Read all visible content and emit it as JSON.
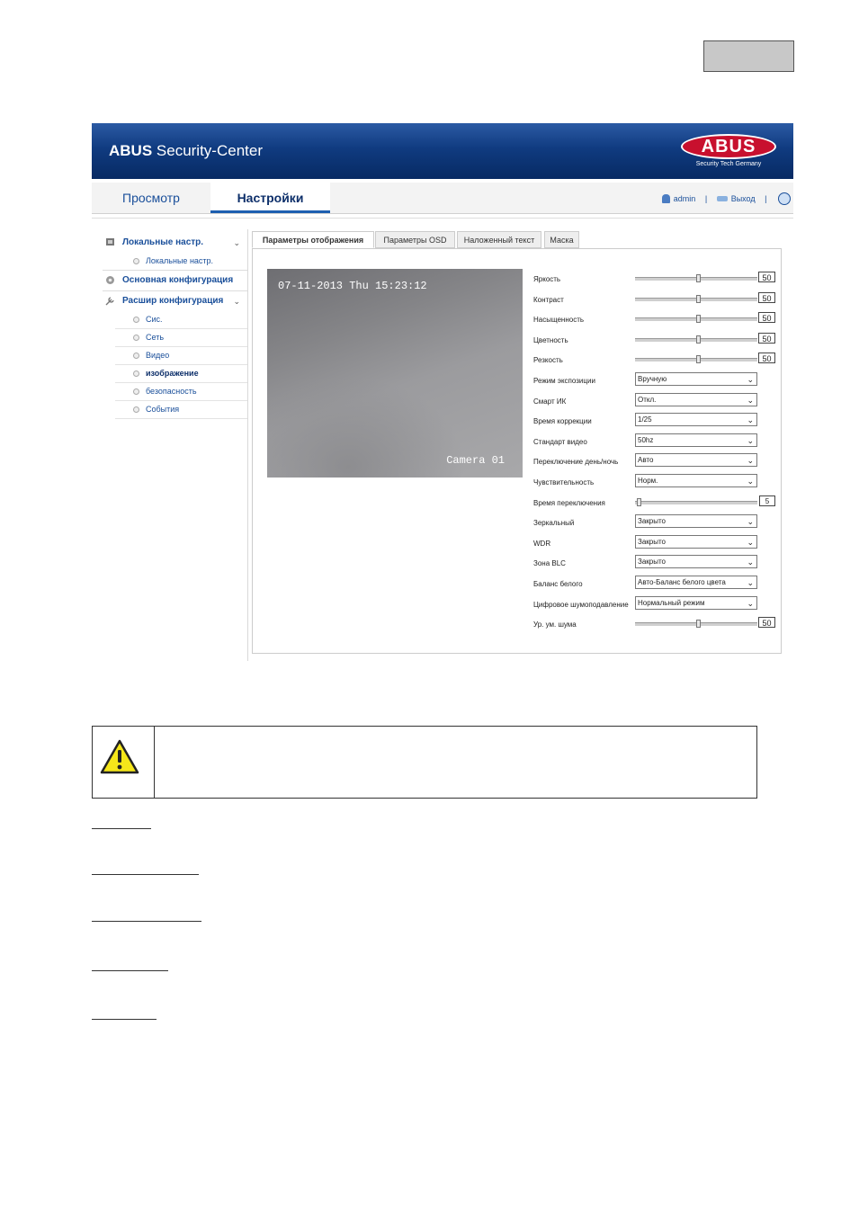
{
  "app": {
    "title_bold": "ABUS",
    "title_rest": " Security-Center",
    "logo_text": "ABUS",
    "logo_sub": "Security Tech Germany"
  },
  "nav": {
    "tabs": [
      {
        "label": "Просмотр"
      },
      {
        "label": "Настройки"
      }
    ],
    "user": "admin",
    "logout": "Выход",
    "separator": "|"
  },
  "sidebar": {
    "sections": [
      {
        "label": "Локальные настр.",
        "icon": "local-settings-icon",
        "items": [
          {
            "label": "Локальные настр."
          }
        ]
      },
      {
        "label": "Основная конфигурация",
        "icon": "gear-icon",
        "items": []
      },
      {
        "label": "Расшир конфигурация",
        "icon": "wrench-icon",
        "items": [
          {
            "label": "Сис."
          },
          {
            "label": "Сеть"
          },
          {
            "label": "Видео"
          },
          {
            "label": "изображение"
          },
          {
            "label": "безопасность"
          },
          {
            "label": "События"
          }
        ]
      }
    ]
  },
  "tabs": [
    {
      "label": "Параметры отображения"
    },
    {
      "label": "Параметры OSD"
    },
    {
      "label": "Наложенный текст"
    },
    {
      "label": "Маска"
    }
  ],
  "video": {
    "timestamp": "07-11-2013 Thu 15:23:12",
    "camera_label": "Camera 01"
  },
  "settings": {
    "brightness": {
      "label": "Яркость",
      "value": "50",
      "level": 0.5
    },
    "contrast": {
      "label": "Контраст",
      "value": "50",
      "level": 0.5
    },
    "saturation": {
      "label": "Насыщенность",
      "value": "50",
      "level": 0.5
    },
    "hue": {
      "label": "Цветность",
      "value": "50",
      "level": 0.5
    },
    "sharpness": {
      "label": "Резкость",
      "value": "50",
      "level": 0.5
    },
    "exposure_mode": {
      "label": "Режим экспозиции",
      "value": "Вручную"
    },
    "smart_ir": {
      "label": "Смарт ИК",
      "value": "Откл."
    },
    "shutter": {
      "label": "Время коррекции",
      "value": "1/25"
    },
    "video_standard": {
      "label": "Стандарт видео",
      "value": "50hz"
    },
    "day_night": {
      "label": "Переключение день/ночь",
      "value": "Авто"
    },
    "sensitivity": {
      "label": "Чувствительность",
      "value": "Норм."
    },
    "switch_time": {
      "label": "Время переключения",
      "value": "5",
      "level": 0.0
    },
    "mirror": {
      "label": "Зеркальный",
      "value": "Закрыто"
    },
    "wdr": {
      "label": "WDR",
      "value": "Закрыто"
    },
    "blc": {
      "label": "Зона BLC",
      "value": "Закрыто"
    },
    "white_balance": {
      "label": "Баланс белого",
      "value": "Авто-Баланс белого цвета"
    },
    "dnr": {
      "label": "Цифровое шумоподавление",
      "value": "Нормальный режим"
    },
    "noise_level": {
      "label": "Ур. ум. шума",
      "value": "50",
      "level": 0.5
    }
  },
  "warning": {
    "icon": "warning-icon"
  }
}
